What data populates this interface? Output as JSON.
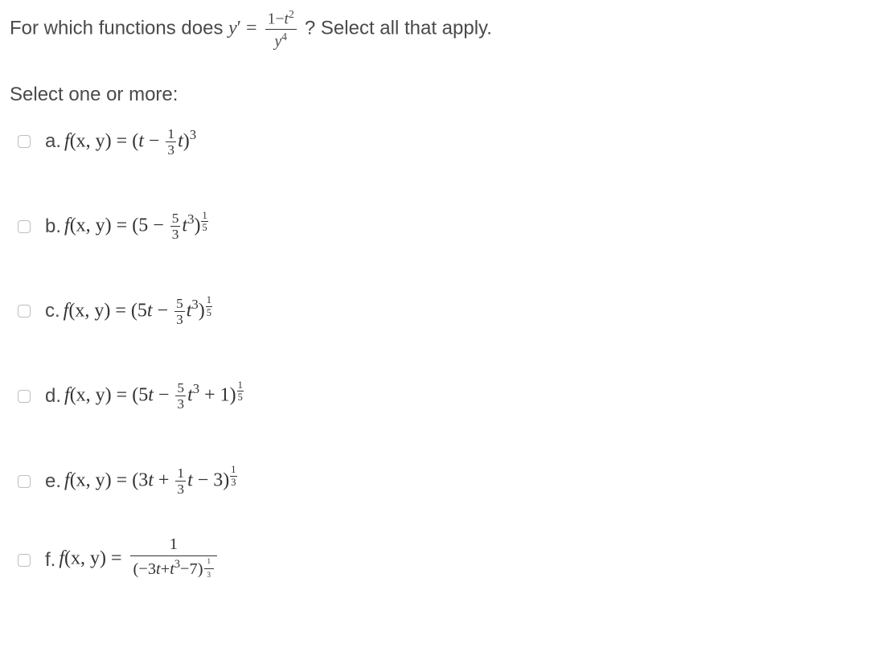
{
  "question": {
    "prefix": "For which functions does ",
    "lhs_var": "y",
    "prime": "′",
    "equals": " = ",
    "frac_num_a": "1",
    "frac_num_op": "−",
    "frac_num_b_var": "t",
    "frac_num_b_exp": "2",
    "frac_den_var": "y",
    "frac_den_exp": "4",
    "suffix": "? Select all that apply."
  },
  "prompt": "Select one or more:",
  "options": [
    {
      "prefix": "a. ",
      "func_lhs": "f",
      "args": "(x, y) = (",
      "t1": "t",
      "op": " − ",
      "coef_num": "1",
      "coef_den": "3",
      "t2": "t",
      "close": ")",
      "outer_exp": "3"
    },
    {
      "prefix": "b. ",
      "func_lhs": "f",
      "args": "(x, y) = (",
      "t1": "5",
      "op": " − ",
      "coef_num": "5",
      "coef_den": "3",
      "t2": "t",
      "t2_exp": "3",
      "close": ")",
      "outer_num": "1",
      "outer_den": "5"
    },
    {
      "prefix": "c. ",
      "func_lhs": "f",
      "args": "(x, y) = (",
      "t1": "5",
      "t1_var": "t",
      "op": " − ",
      "coef_num": "5",
      "coef_den": "3",
      "t2": "t",
      "t2_exp": "3",
      "close": ")",
      "outer_num": "1",
      "outer_den": "5"
    },
    {
      "prefix": "d. ",
      "func_lhs": "f",
      "args": "(x, y) = (",
      "t1": "5",
      "t1_var": "t",
      "op": " − ",
      "coef_num": "5",
      "coef_den": "3",
      "t2": "t",
      "t2_exp": "3",
      "op2": " + 1",
      "close": ")",
      "outer_num": "1",
      "outer_den": "5"
    },
    {
      "prefix": "e. ",
      "func_lhs": "f",
      "args": "(x, y) = (",
      "t1": "3",
      "t1_var": "t",
      "op": " + ",
      "coef_num": "1",
      "coef_den": "3",
      "t2": "t",
      "op2": " − 3",
      "close": ")",
      "outer_num": "1",
      "outer_den": "3"
    },
    {
      "prefix": "f. ",
      "func_lhs": "f",
      "args": "(x, y) = ",
      "bignum": "1",
      "bigden_a": "(−3",
      "bigden_t1": "t",
      "bigden_b": "+",
      "bigden_t2": "t",
      "bigden_t2_exp": "3",
      "bigden_c": "−7)",
      "bigden_exp_num": "1",
      "bigden_exp_den": "3"
    }
  ]
}
